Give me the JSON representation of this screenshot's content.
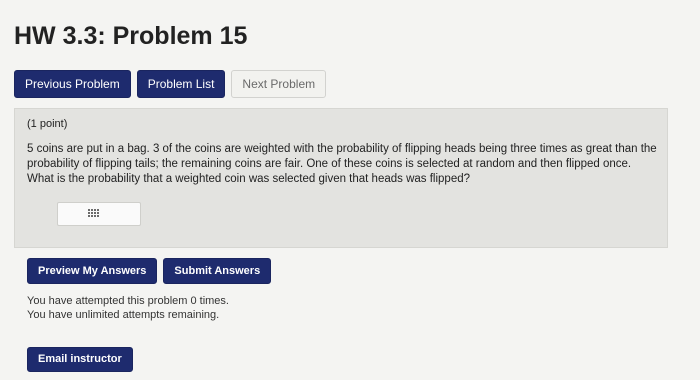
{
  "page": {
    "title": "HW 3.3: Problem 15"
  },
  "nav": {
    "previous_label": "Previous Problem",
    "list_label": "Problem List",
    "next_label": "Next Problem"
  },
  "problem": {
    "points": "(1 point)",
    "text": "5 coins are put in a bag. 3 of the coins are weighted with the probability of flipping heads being three times as great than the probability of flipping tails; the remaining coins are fair. One of these coins is selected at random and then flipped once. What is the probability that a weighted coin was selected given that heads was flipped?",
    "answer_value": "",
    "answer_icon": "equation-editor-icon"
  },
  "actions": {
    "preview_label": "Preview My Answers",
    "submit_label": "Submit Answers"
  },
  "attempts": {
    "line1": "You have attempted this problem 0 times.",
    "line2": "You have unlimited attempts remaining."
  },
  "footer": {
    "email_label": "Email instructor"
  },
  "colors": {
    "primary_button": "#1e2b6e",
    "disabled_button_text": "#6a6a6a",
    "problem_background": "#e3e3e0"
  }
}
